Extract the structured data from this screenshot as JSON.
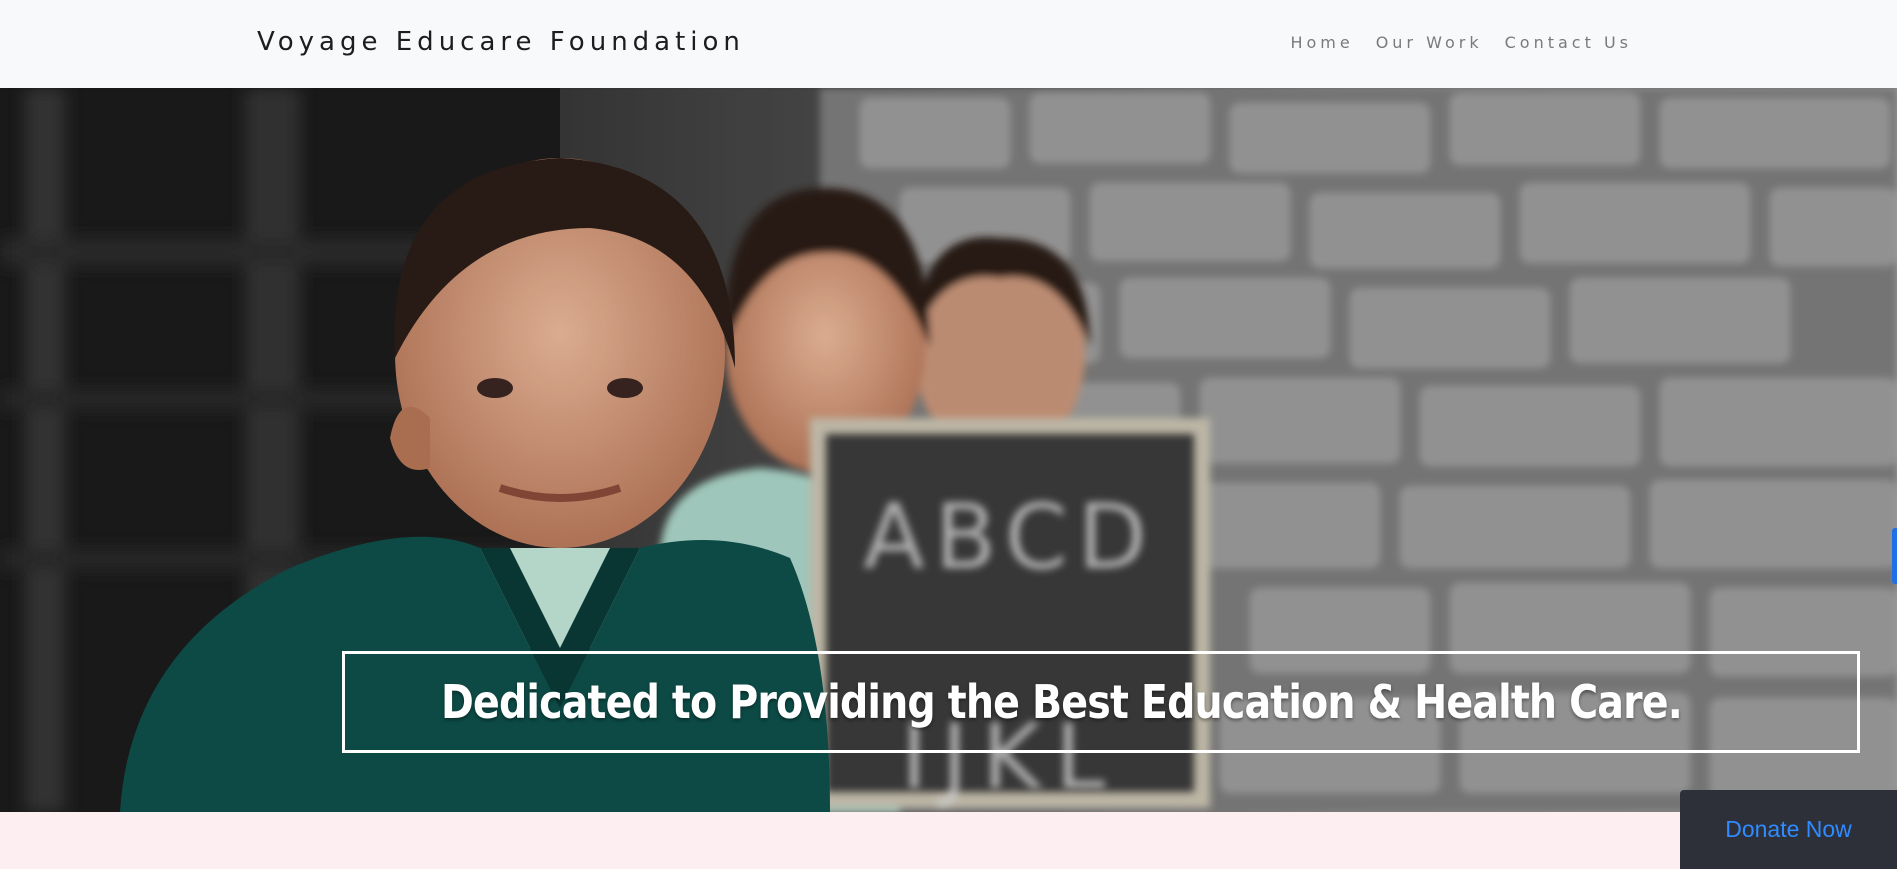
{
  "header": {
    "brand": "Voyage Educare Foundation",
    "nav": [
      {
        "label": "Home"
      },
      {
        "label": "Our Work"
      },
      {
        "label": "Contact Us"
      }
    ]
  },
  "hero": {
    "tagline": "Dedicated to Providing the Best Education & Health Care.",
    "chalkboard_text": "ABCD EFG IJKL"
  },
  "cta": {
    "donate_label": "Donate Now"
  },
  "colors": {
    "navbar_bg": "#f8f9fa",
    "footer_bg": "#fdeef1",
    "donate_bg": "#2d3039",
    "donate_text": "#2f8bff",
    "accent_tab": "#1e6fe8"
  }
}
